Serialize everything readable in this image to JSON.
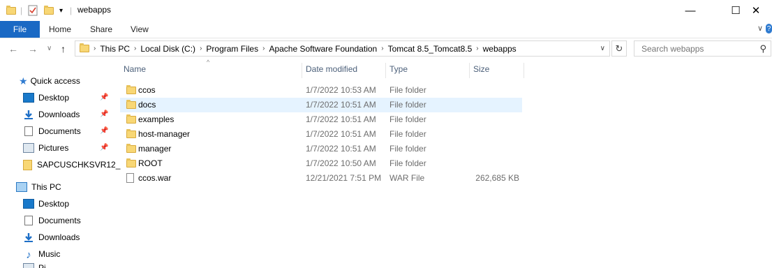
{
  "window": {
    "title": "webapps",
    "minimize_glyph": "—",
    "maximize_glyph": "☐",
    "close_glyph": "✕"
  },
  "ribbon": {
    "tabs": [
      "File",
      "Home",
      "Share",
      "View"
    ],
    "expand_glyph": "∨",
    "help_glyph": "?"
  },
  "address": {
    "back_glyph": "←",
    "forward_glyph": "→",
    "recent_glyph": "∨",
    "up_glyph": "↑",
    "breadcrumbs": [
      "This PC",
      "Local Disk (C:)",
      "Program Files",
      "Apache Software Foundation",
      "Tomcat 8.5_Tomcat8.5",
      "webapps"
    ],
    "separator": "›",
    "refresh_glyph": "↻",
    "search_placeholder": "Search webapps"
  },
  "nav": {
    "quick_access": "Quick access",
    "quick_items": [
      "Desktop",
      "Downloads",
      "Documents",
      "Pictures",
      "SAPCUSCHKSVR12_"
    ],
    "this_pc": "This PC",
    "pc_items": [
      "Desktop",
      "Documents",
      "Downloads",
      "Music",
      "Pi"
    ]
  },
  "columns": {
    "name": "Name",
    "date": "Date modified",
    "type": "Type",
    "size": "Size"
  },
  "files": [
    {
      "name": "ccos",
      "date": "1/7/2022 10:53 AM",
      "type": "File folder",
      "size": "",
      "kind": "folder"
    },
    {
      "name": "docs",
      "date": "1/7/2022 10:51 AM",
      "type": "File folder",
      "size": "",
      "kind": "folder",
      "selected": true
    },
    {
      "name": "examples",
      "date": "1/7/2022 10:51 AM",
      "type": "File folder",
      "size": "",
      "kind": "folder"
    },
    {
      "name": "host-manager",
      "date": "1/7/2022 10:51 AM",
      "type": "File folder",
      "size": "",
      "kind": "folder"
    },
    {
      "name": "manager",
      "date": "1/7/2022 10:51 AM",
      "type": "File folder",
      "size": "",
      "kind": "folder"
    },
    {
      "name": "ROOT",
      "date": "1/7/2022 10:50 AM",
      "type": "File folder",
      "size": "",
      "kind": "folder"
    },
    {
      "name": "ccos.war",
      "date": "12/21/2021 7:51 PM",
      "type": "WAR File",
      "size": "262,685 KB",
      "kind": "file"
    }
  ],
  "colors": {
    "accent": "#1a69c4",
    "selection": "#e5f3ff",
    "folder": "#f8d775"
  }
}
